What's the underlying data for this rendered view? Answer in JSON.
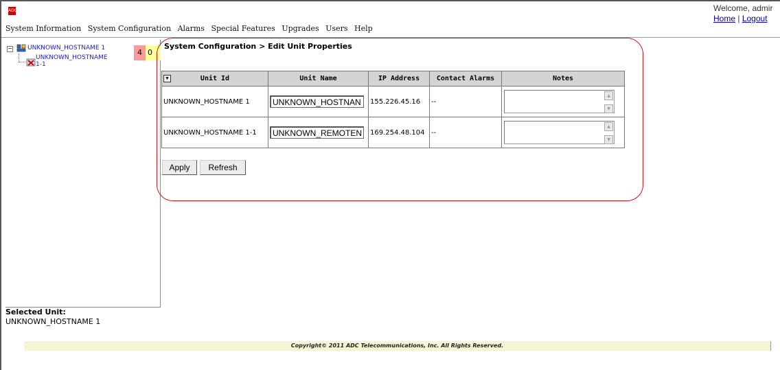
{
  "header": {
    "logo_text": "ADC",
    "welcome": "Welcome, admir",
    "home_link": "Home",
    "separator": "|",
    "logout_link": "Logout"
  },
  "menu": [
    "System Information",
    "System Configuration",
    "Alarms",
    "Special Features",
    "Upgrades",
    "Users",
    "Help"
  ],
  "tree": {
    "root_label": "UNKNOWN_HOSTNAME 1",
    "child_label_line1": "UNKNOWN_HOSTNAME",
    "child_label_line2": "1-1",
    "alarm_red_count": "4",
    "alarm_yellow_count": "0"
  },
  "selected_unit": {
    "label": "Selected Unit:",
    "value": "UNKNOWN_HOSTNAME 1"
  },
  "breadcrumb": "System Configuration > Edit Unit Properties",
  "table": {
    "headers": [
      "Unit Id",
      "Unit Name",
      "IP Address",
      "Contact Alarms",
      "Notes"
    ],
    "rows": [
      {
        "unit_id": "UNKNOWN_HOSTNAME 1",
        "unit_name": "UNKNOWN_HOSTNAN",
        "ip": "155.226.45.16",
        "contact_alarms": "--",
        "notes": ""
      },
      {
        "unit_id": "UNKNOWN_HOSTNAME 1-1",
        "unit_name": "UNKNOWN_REMOTEN",
        "ip": "169.254.48.104",
        "contact_alarms": "--",
        "notes": ""
      }
    ]
  },
  "buttons": {
    "apply": "Apply",
    "refresh": "Refresh"
  },
  "footer": {
    "copyright": "Copyright© 2011 ADC Telecommunications, Inc. All Rights Reserved."
  },
  "colors": {
    "highlight": "#dd1111",
    "link": "#0000cc",
    "alarm_red": "#ff9999",
    "alarm_yellow": "#ffff99",
    "footer_bg": "#f6f4d2"
  }
}
